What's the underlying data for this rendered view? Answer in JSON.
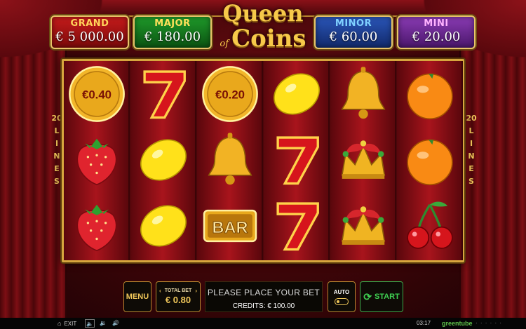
{
  "jackpots": {
    "grand": {
      "label": "GRAND",
      "value": "€ 5 000.00"
    },
    "major": {
      "label": "MAJOR",
      "value": "€ 180.00"
    },
    "minor": {
      "label": "MINOR",
      "value": "€ 60.00"
    },
    "mini": {
      "label": "MINI",
      "value": "€ 20.00"
    }
  },
  "logo": {
    "line1": "Queen",
    "line2": "of",
    "line3": "Coins"
  },
  "lines": {
    "count": "20",
    "word": "LINES"
  },
  "reels": [
    [
      "coin-icon",
      "strawberry-icon",
      "strawberry-icon"
    ],
    [
      "seven-icon",
      "lemon-icon",
      "lemon-icon"
    ],
    [
      "coin-icon",
      "bell-icon",
      "bar-icon"
    ],
    [
      "lemon-icon",
      "seven-icon",
      "seven-icon"
    ],
    [
      "bell-icon",
      "jester-crown-icon",
      "jester-crown-icon"
    ],
    [
      "orange-icon",
      "orange-icon",
      "cherry-icon"
    ]
  ],
  "coin_values": {
    "reel1": "€0.40",
    "reel3": "€0.20"
  },
  "bar_text": "BAR",
  "controls": {
    "menu_label": "MENU",
    "total_bet_label": "TOTAL BET",
    "total_bet_value": "€ 0.80",
    "message": "PLEASE PLACE YOUR BET",
    "credits": "CREDITS: € 100.00",
    "auto_label": "AUTO",
    "start_label": "START"
  },
  "statusbar": {
    "exit_label": "EXIT",
    "time": "03:17",
    "brand": "greentube"
  },
  "colors": {
    "gold": "#f0c75a",
    "start_green": "#3fd152",
    "reel_red": "#a8141c"
  }
}
